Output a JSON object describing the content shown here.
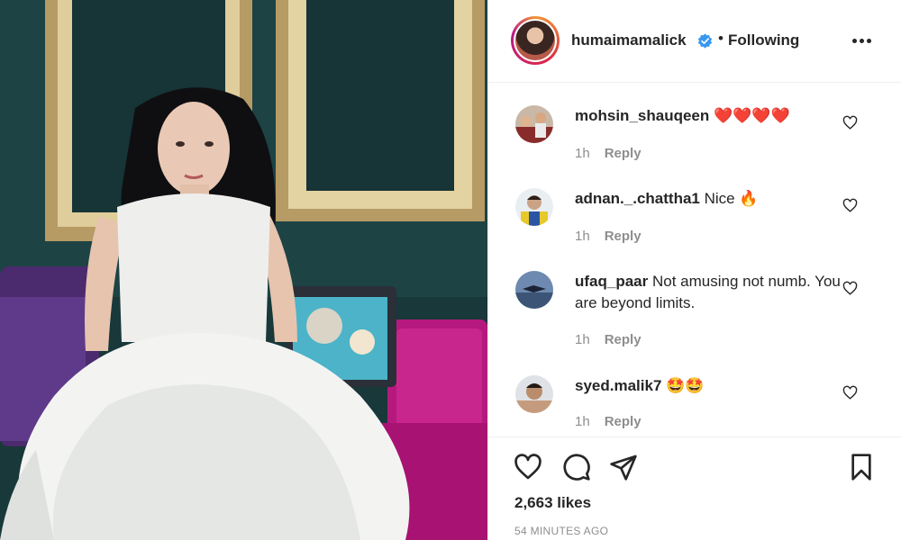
{
  "post": {
    "username": "humaimamalick",
    "follow_status": "Following",
    "separator": "•",
    "verified": true,
    "likes": "2,663 likes",
    "time_ago": "54 MINUTES AGO"
  },
  "comments": [
    {
      "user": "mohsin_shauqeen",
      "text": "❤️❤️❤️❤️",
      "time": "1h",
      "reply": "Reply"
    },
    {
      "user": "adnan._.chattha1",
      "text": "Nice 🔥",
      "time": "1h",
      "reply": "Reply"
    },
    {
      "user": "ufaq_paar",
      "text": "Not amusing not numb. You are beyond limits.",
      "time": "1h",
      "reply": "Reply"
    },
    {
      "user": "syed.malik7",
      "text": "🤩🤩",
      "time": "1h",
      "reply": "Reply"
    }
  ],
  "icons": {
    "verified": "verified-badge-icon",
    "more": "more-options-icon",
    "like": "heart-icon",
    "comment": "comment-icon",
    "share": "paper-plane-icon",
    "save": "bookmark-icon"
  },
  "colors": {
    "verified_blue": "#3897f0",
    "text": "#262626",
    "muted": "#8e8e8e",
    "divider": "#efefef"
  }
}
